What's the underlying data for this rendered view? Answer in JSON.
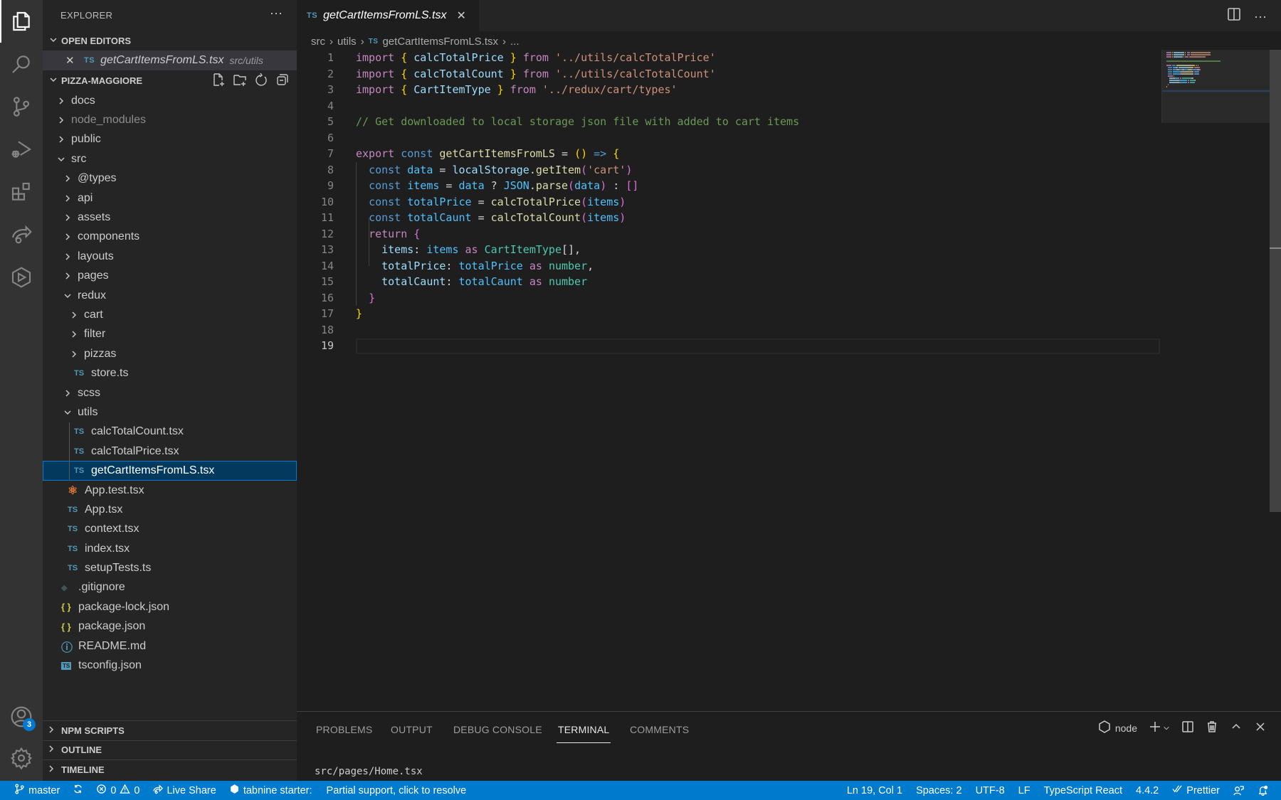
{
  "activity_bar": {
    "items": [
      {
        "name": "explorer",
        "active": true
      },
      {
        "name": "search"
      },
      {
        "name": "source-control"
      },
      {
        "name": "run-debug"
      },
      {
        "name": "extensions"
      },
      {
        "name": "live-share"
      },
      {
        "name": "remote-explorer"
      }
    ],
    "accounts_badge": "3"
  },
  "sidebar": {
    "title": "EXPLORER",
    "more": "···",
    "open_editors": {
      "label": "OPEN EDITORS",
      "items": [
        {
          "icon": "TS",
          "name": "getCartItemsFromLS.tsx",
          "path": "src/utils"
        }
      ]
    },
    "project": {
      "label": "PIZZA-MAGGIORE",
      "tree": [
        {
          "label": "docs",
          "type": "folder",
          "depth": 0,
          "expanded": false
        },
        {
          "label": "node_modules",
          "type": "folder",
          "depth": 0,
          "expanded": false,
          "dim": true
        },
        {
          "label": "public",
          "type": "folder",
          "depth": 0,
          "expanded": false
        },
        {
          "label": "src",
          "type": "folder",
          "depth": 0,
          "expanded": true
        },
        {
          "label": "@types",
          "type": "folder",
          "depth": 1,
          "expanded": false
        },
        {
          "label": "api",
          "type": "folder",
          "depth": 1,
          "expanded": false
        },
        {
          "label": "assets",
          "type": "folder",
          "depth": 1,
          "expanded": false
        },
        {
          "label": "components",
          "type": "folder",
          "depth": 1,
          "expanded": false
        },
        {
          "label": "layouts",
          "type": "folder",
          "depth": 1,
          "expanded": false
        },
        {
          "label": "pages",
          "type": "folder",
          "depth": 1,
          "expanded": false
        },
        {
          "label": "redux",
          "type": "folder",
          "depth": 1,
          "expanded": true
        },
        {
          "label": "cart",
          "type": "folder",
          "depth": 2,
          "expanded": false
        },
        {
          "label": "filter",
          "type": "folder",
          "depth": 2,
          "expanded": false
        },
        {
          "label": "pizzas",
          "type": "folder",
          "depth": 2,
          "expanded": false
        },
        {
          "label": "store.ts",
          "type": "file",
          "icon": "TS",
          "depth": 2
        },
        {
          "label": "scss",
          "type": "folder",
          "depth": 1,
          "expanded": false
        },
        {
          "label": "utils",
          "type": "folder",
          "depth": 1,
          "expanded": true
        },
        {
          "label": "calcTotalCount.tsx",
          "type": "file",
          "icon": "TS",
          "depth": 2
        },
        {
          "label": "calcTotalPrice.tsx",
          "type": "file",
          "icon": "TS",
          "depth": 2
        },
        {
          "label": "getCartItemsFromLS.tsx",
          "type": "file",
          "icon": "TS",
          "depth": 2,
          "selected": true
        },
        {
          "label": "App.test.tsx",
          "type": "file",
          "icon": "react",
          "depth": 1
        },
        {
          "label": "App.tsx",
          "type": "file",
          "icon": "TS",
          "depth": 1
        },
        {
          "label": "context.tsx",
          "type": "file",
          "icon": "TS",
          "depth": 1
        },
        {
          "label": "index.tsx",
          "type": "file",
          "icon": "TS",
          "depth": 1
        },
        {
          "label": "setupTests.ts",
          "type": "file",
          "icon": "TS",
          "depth": 1
        },
        {
          "label": ".gitignore",
          "type": "file",
          "icon": "git",
          "depth": 0
        },
        {
          "label": "package-lock.json",
          "type": "file",
          "icon": "json",
          "depth": 0
        },
        {
          "label": "package.json",
          "type": "file",
          "icon": "json",
          "depth": 0
        },
        {
          "label": "README.md",
          "type": "file",
          "icon": "info",
          "depth": 0
        },
        {
          "label": "tsconfig.json",
          "type": "file",
          "icon": "tsconfig",
          "depth": 0
        }
      ]
    },
    "bottom_sections": [
      "NPM SCRIPTS",
      "OUTLINE",
      "TIMELINE"
    ]
  },
  "editor": {
    "tab": {
      "icon": "TS",
      "label": "getCartItemsFromLS.tsx"
    },
    "breadcrumb": [
      "src",
      "utils",
      "getCartItemsFromLS.tsx",
      "..."
    ],
    "active_line": 19,
    "lines": [
      [
        [
          "kw",
          "import"
        ],
        [
          "op",
          " "
        ],
        [
          "b1",
          "{"
        ],
        [
          "op",
          " "
        ],
        [
          "prop",
          "calcTotalPrice"
        ],
        [
          "op",
          " "
        ],
        [
          "b1",
          "}"
        ],
        [
          "op",
          " "
        ],
        [
          "kw",
          "from"
        ],
        [
          "op",
          " "
        ],
        [
          "str",
          "'../utils/calcTotalPrice'"
        ]
      ],
      [
        [
          "kw",
          "import"
        ],
        [
          "op",
          " "
        ],
        [
          "b1",
          "{"
        ],
        [
          "op",
          " "
        ],
        [
          "prop",
          "calcTotalCount"
        ],
        [
          "op",
          " "
        ],
        [
          "b1",
          "}"
        ],
        [
          "op",
          " "
        ],
        [
          "kw",
          "from"
        ],
        [
          "op",
          " "
        ],
        [
          "str",
          "'../utils/calcTotalCount'"
        ]
      ],
      [
        [
          "kw",
          "import"
        ],
        [
          "op",
          " "
        ],
        [
          "b1",
          "{"
        ],
        [
          "op",
          " "
        ],
        [
          "prop",
          "CartItemType"
        ],
        [
          "op",
          " "
        ],
        [
          "b1",
          "}"
        ],
        [
          "op",
          " "
        ],
        [
          "kw",
          "from"
        ],
        [
          "op",
          " "
        ],
        [
          "str",
          "'../redux/cart/types'"
        ]
      ],
      [],
      [
        [
          "cm",
          "// Get downloaded to local storage json file with added to cart items"
        ]
      ],
      [],
      [
        [
          "kw",
          "export"
        ],
        [
          "op",
          " "
        ],
        [
          "st",
          "const"
        ],
        [
          "op",
          " "
        ],
        [
          "fn",
          "getCartItemsFromLS"
        ],
        [
          "op",
          " = "
        ],
        [
          "b1",
          "()"
        ],
        [
          "op",
          " "
        ],
        [
          "st",
          "=>"
        ],
        [
          "op",
          " "
        ],
        [
          "b1",
          "{"
        ]
      ],
      [
        [
          "op",
          "  "
        ],
        [
          "st",
          "const"
        ],
        [
          "op",
          " "
        ],
        [
          "var",
          "data"
        ],
        [
          "op",
          " = "
        ],
        [
          "prop",
          "localStorage"
        ],
        [
          "op",
          "."
        ],
        [
          "fn",
          "getItem"
        ],
        [
          "b2",
          "("
        ],
        [
          "str",
          "'cart'"
        ],
        [
          "b2",
          ")"
        ]
      ],
      [
        [
          "op",
          "  "
        ],
        [
          "st",
          "const"
        ],
        [
          "op",
          " "
        ],
        [
          "var",
          "items"
        ],
        [
          "op",
          " = "
        ],
        [
          "var",
          "data"
        ],
        [
          "op",
          " ? "
        ],
        [
          "var",
          "JSON"
        ],
        [
          "op",
          "."
        ],
        [
          "fn",
          "parse"
        ],
        [
          "b2",
          "("
        ],
        [
          "var",
          "data"
        ],
        [
          "b2",
          ")"
        ],
        [
          "op",
          " : "
        ],
        [
          "b2",
          "[]"
        ]
      ],
      [
        [
          "op",
          "  "
        ],
        [
          "st",
          "const"
        ],
        [
          "op",
          " "
        ],
        [
          "var",
          "totalPrice"
        ],
        [
          "op",
          " = "
        ],
        [
          "fn",
          "calcTotalPrice"
        ],
        [
          "b2",
          "("
        ],
        [
          "var",
          "items"
        ],
        [
          "b2",
          ")"
        ]
      ],
      [
        [
          "op",
          "  "
        ],
        [
          "st",
          "const"
        ],
        [
          "op",
          " "
        ],
        [
          "var",
          "totalCaunt"
        ],
        [
          "op",
          " = "
        ],
        [
          "fn",
          "calcTotalCount"
        ],
        [
          "b2",
          "("
        ],
        [
          "var",
          "items"
        ],
        [
          "b2",
          ")"
        ]
      ],
      [
        [
          "op",
          "  "
        ],
        [
          "kw",
          "return"
        ],
        [
          "op",
          " "
        ],
        [
          "b2",
          "{"
        ]
      ],
      [
        [
          "op",
          "    "
        ],
        [
          "prop",
          "items"
        ],
        [
          "op",
          ": "
        ],
        [
          "var",
          "items"
        ],
        [
          "op",
          " "
        ],
        [
          "kw",
          "as"
        ],
        [
          "op",
          " "
        ],
        [
          "ty",
          "CartItemType"
        ],
        [
          "op",
          "[],"
        ]
      ],
      [
        [
          "op",
          "    "
        ],
        [
          "prop",
          "totalPrice"
        ],
        [
          "op",
          ": "
        ],
        [
          "var",
          "totalPrice"
        ],
        [
          "op",
          " "
        ],
        [
          "kw",
          "as"
        ],
        [
          "op",
          " "
        ],
        [
          "ty",
          "number"
        ],
        [
          "op",
          ","
        ]
      ],
      [
        [
          "op",
          "    "
        ],
        [
          "prop",
          "totalCaunt"
        ],
        [
          "op",
          ": "
        ],
        [
          "var",
          "totalCaunt"
        ],
        [
          "op",
          " "
        ],
        [
          "kw",
          "as"
        ],
        [
          "op",
          " "
        ],
        [
          "ty",
          "number"
        ]
      ],
      [
        [
          "op",
          "  "
        ],
        [
          "b2",
          "}"
        ]
      ],
      [
        [
          "b1",
          "}"
        ]
      ],
      [],
      []
    ]
  },
  "panel": {
    "tabs": [
      "PROBLEMS",
      "OUTPUT",
      "DEBUG CONSOLE",
      "TERMINAL",
      "COMMENTS"
    ],
    "active_tab": "TERMINAL",
    "terminal_name": "node",
    "terminal_text": "src/pages/Home.tsx"
  },
  "statusbar": {
    "branch": "master",
    "errors": "0",
    "warnings": "0",
    "live_share": "Live Share",
    "tabnine": "tabnine starter:",
    "tabnine_msg": "Partial support, click to resolve",
    "position": "Ln 19, Col 1",
    "spaces": "Spaces: 2",
    "encoding": "UTF-8",
    "eol": "LF",
    "language": "TypeScript React",
    "ts_version": "4.4.2",
    "prettier": "Prettier"
  },
  "colors": {
    "statusbar": "#007acc",
    "selection": "#04395e",
    "accent": "#0078d4"
  }
}
